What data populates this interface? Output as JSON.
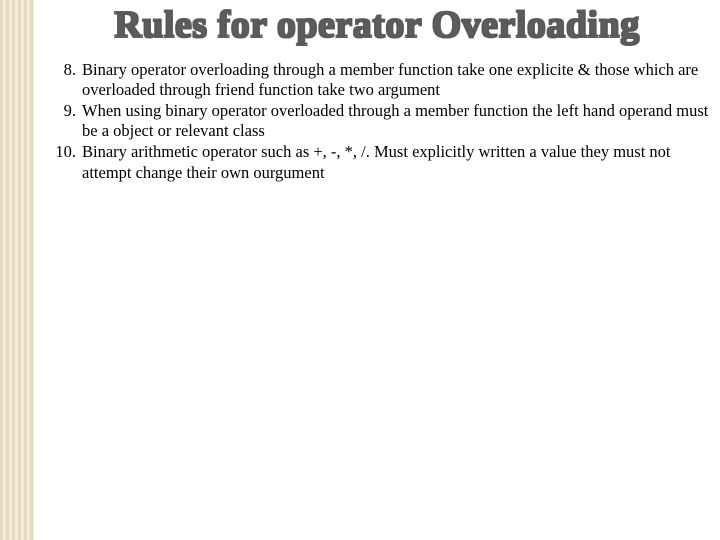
{
  "slide": {
    "title": "Rules for operator Overloading",
    "items": [
      {
        "n": "8.",
        "text": "Binary operator overloading through a member function take one explicite & those which are overloaded through friend function take two argument"
      },
      {
        "n": "9.",
        "text": "When using binary operator overloaded through a member function  the left hand operand must be a object or relevant class"
      },
      {
        "n": "10.",
        "text": "Binary arithmetic operator such as +, -, *, /. Must explicitly written a value they must not attempt change their own ourgument"
      }
    ]
  }
}
